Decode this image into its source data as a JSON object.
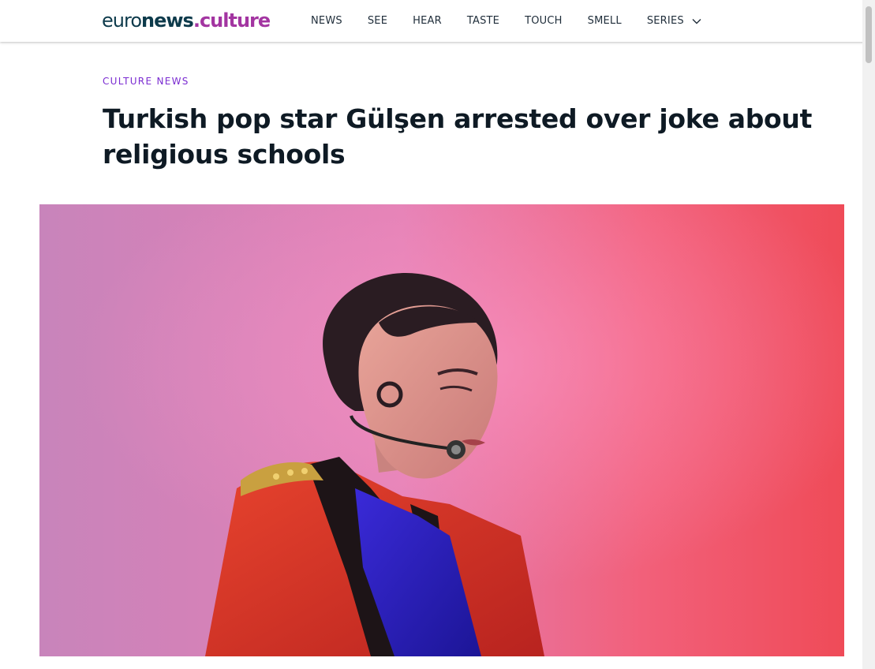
{
  "header": {
    "logo": {
      "part1": "euro",
      "part2": "news",
      "part3": ".",
      "part4": "culture"
    },
    "nav": [
      {
        "label": "NEWS"
      },
      {
        "label": "SEE"
      },
      {
        "label": "HEAR"
      },
      {
        "label": "TASTE"
      },
      {
        "label": "TOUCH"
      },
      {
        "label": "SMELL"
      },
      {
        "label": "SERIES",
        "icon": "chevron-down-icon"
      }
    ]
  },
  "article": {
    "category": "CULTURE NEWS",
    "title": "Turkish pop star Gülşen arrested over joke about religious schools",
    "hero_image": {
      "icon": "hero-photo"
    }
  },
  "colors": {
    "brand_dark": "#0d3a4b",
    "brand_accent": "#a335a1",
    "category": "#7a2bd1",
    "headline": "#0e1a24",
    "photo_bg_left": "#c27bb6",
    "photo_bg_right": "#f0505a"
  }
}
